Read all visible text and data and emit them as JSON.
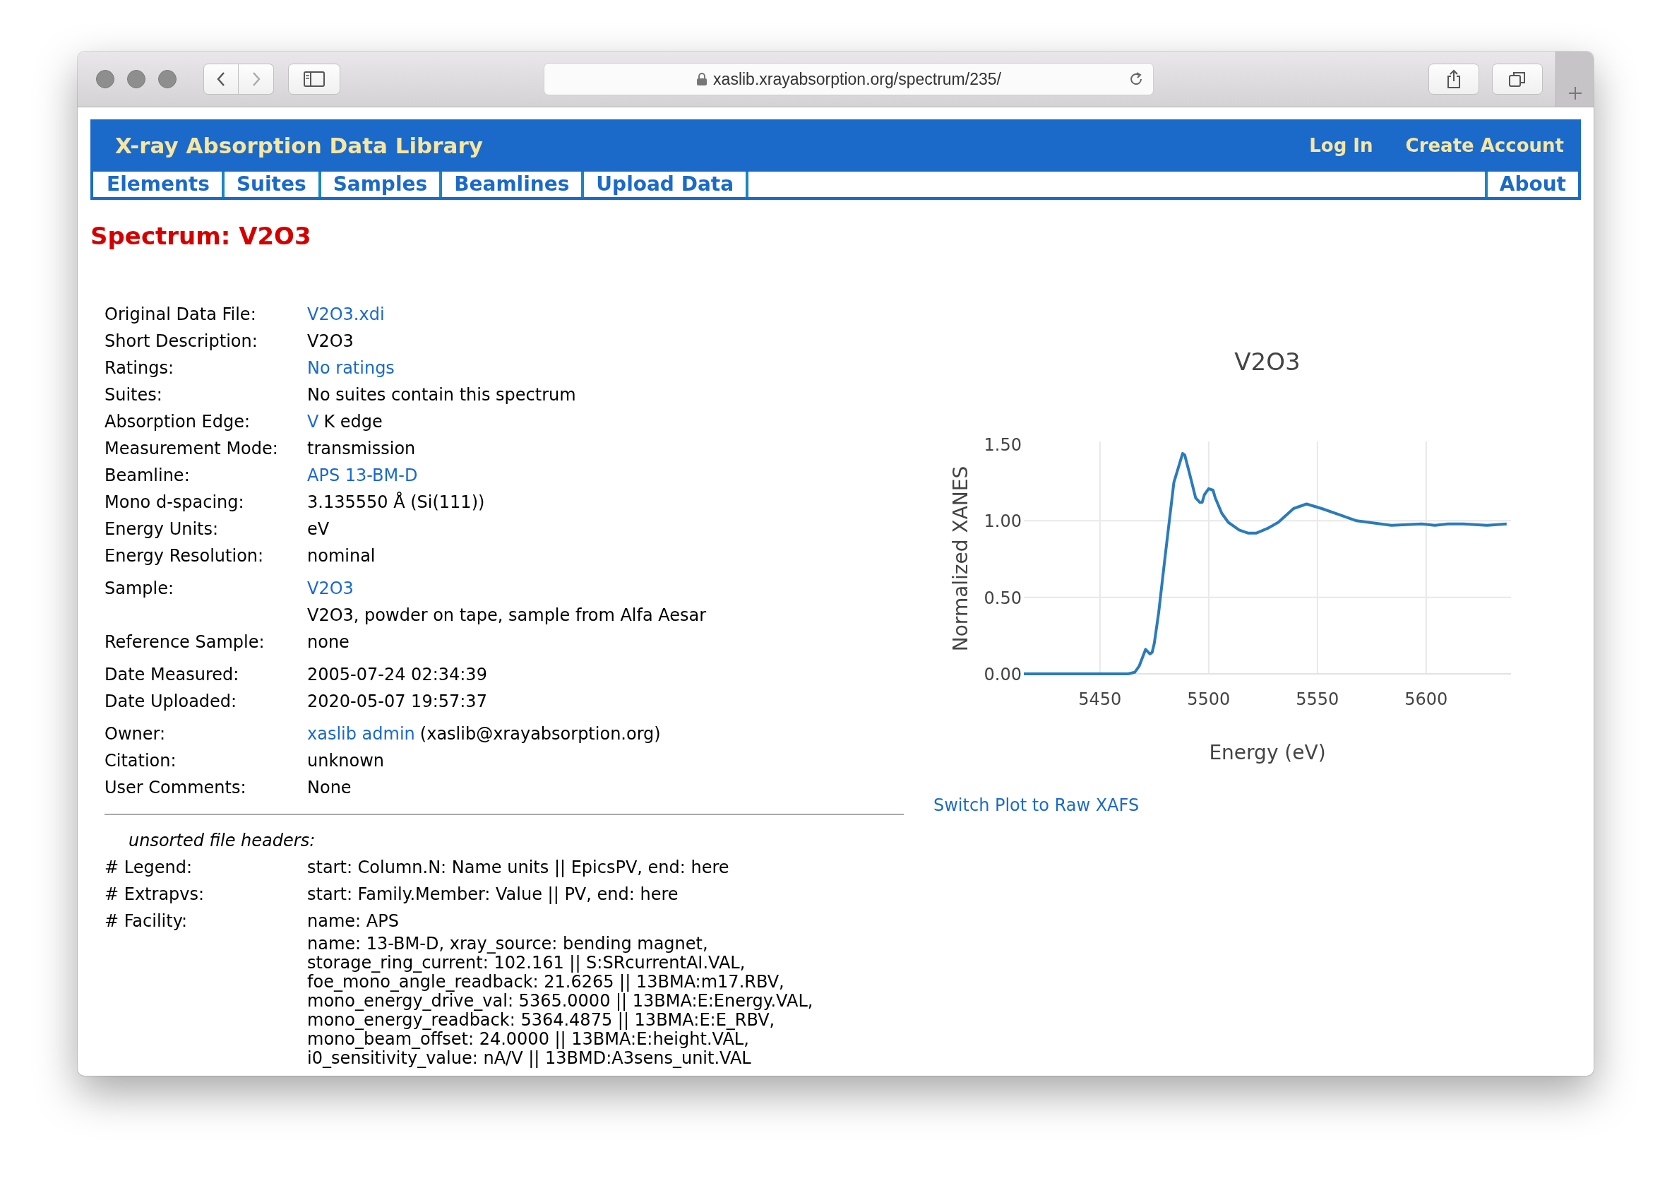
{
  "browser": {
    "url": "xaslib.xrayabsorption.org/spectrum/235/"
  },
  "site": {
    "title": "X-ray Absorption Data Library",
    "account_links": [
      "Log In",
      "Create Account"
    ],
    "nav": [
      {
        "label": "Elements"
      },
      {
        "label": "Suites"
      },
      {
        "label": "Samples"
      },
      {
        "label": "Beamlines"
      },
      {
        "label": "Upload Data"
      }
    ],
    "nav_right": [
      {
        "label": "About"
      }
    ]
  },
  "page_title": "Spectrum: V2O3",
  "details": [
    [
      {
        "label": "Original Data File:",
        "value": [
          {
            "text": "V2O3.xdi",
            "link": true
          }
        ]
      },
      {
        "label": "Short Description:",
        "value": [
          {
            "text": "V2O3",
            "link": false
          }
        ]
      },
      {
        "label": "Ratings:",
        "value": [
          {
            "text": "No ratings",
            "link": true
          }
        ]
      },
      {
        "label": "Suites:",
        "value": [
          {
            "text": "No suites contain this spectrum",
            "link": false
          }
        ]
      },
      {
        "label": "Absorption Edge:",
        "value": [
          {
            "text": "V",
            "link": true
          },
          {
            "text": "K edge",
            "link": false
          }
        ]
      },
      {
        "label": "Measurement Mode:",
        "value": [
          {
            "text": "transmission",
            "link": false
          }
        ]
      },
      {
        "label": "Beamline:",
        "value": [
          {
            "text": "APS 13-BM-D",
            "link": true
          }
        ]
      },
      {
        "label": "Mono d-spacing:",
        "value": [
          {
            "text": "3.135550 Å (Si(111))",
            "link": false
          }
        ]
      },
      {
        "label": "Energy Units:",
        "value": [
          {
            "text": "eV",
            "link": false
          }
        ]
      },
      {
        "label": "Energy Resolution:",
        "value": [
          {
            "text": "nominal",
            "link": false
          }
        ]
      }
    ],
    [
      {
        "label": "Sample:",
        "value": [
          {
            "text": "V2O3",
            "link": true
          }
        ]
      },
      {
        "value": [
          {
            "text": "V2O3, powder on tape, sample from Alfa Aesar",
            "link": false
          }
        ]
      },
      {
        "label": "Reference Sample:",
        "value": [
          {
            "text": "none",
            "link": false
          }
        ]
      }
    ],
    [
      {
        "label": "Date Measured:",
        "value": [
          {
            "text": "2005-07-24 02:34:39",
            "link": false
          }
        ]
      },
      {
        "label": "Date Uploaded:",
        "value": [
          {
            "text": "2020-05-07 19:57:37",
            "link": false
          }
        ]
      }
    ],
    [
      {
        "label": "Owner:",
        "value": [
          {
            "text": "xaslib admin",
            "link": true
          },
          {
            "text": "(xaslib@xrayabsorption.org)",
            "link": false
          }
        ]
      },
      {
        "label": "Citation:",
        "value": [
          {
            "text": "unknown",
            "link": false
          }
        ]
      },
      {
        "label": "User Comments:",
        "value": [
          {
            "text": "None",
            "link": false
          }
        ]
      }
    ]
  ],
  "headers": {
    "heading": "unsorted file headers:",
    "rows": [
      {
        "label": "# Legend:",
        "lines": [
          "start: Column.N: Name units || EpicsPV, end: here"
        ]
      },
      {
        "label": "# Extrapvs:",
        "lines": [
          "start: Family.Member: Value || PV, end: here"
        ]
      },
      {
        "label": "# Facility:",
        "lines": [
          "name: APS"
        ]
      },
      {
        "lines": [
          "name: 13-BM-D, xray_source: bending magnet,",
          "storage_ring_current: 102.161 || S:SRcurrentAI.VAL,",
          "foe_mono_angle_readback: 21.6265 || 13BMA:m17.RBV,",
          "mono_energy_drive_val: 5365.0000 || 13BMA:E:Energy.VAL,",
          "mono_energy_readback: 5364.4875 || 13BMA:E:E_RBV,",
          "mono_beam_offset: 24.0000 || 13BMA:E:height.VAL,",
          "i0_sensitivity_value: nA/V || 13BMD:A3sens_unit.VAL"
        ]
      }
    ]
  },
  "plot": {
    "chart_data": {
      "type": "line",
      "grid": true,
      "title": "V2O3",
      "xlabel": "Energy (eV)",
      "ylabel": "Normalized XANES",
      "xlim": [
        5415,
        5639
      ],
      "ylim": [
        0,
        1.5
      ],
      "xticks": [
        5450,
        5500,
        5550,
        5600
      ],
      "yticks": [
        {
          "value": 0,
          "label": "0.00"
        },
        {
          "value": 0.5,
          "label": "0.50"
        },
        {
          "value": 1,
          "label": "1.00"
        },
        {
          "value": 1.5,
          "label": "1.50"
        }
      ],
      "x": [
        5415,
        5463,
        5466,
        5468,
        5471,
        5473,
        5474,
        5475,
        5477,
        5480,
        5484,
        5488,
        5489,
        5491,
        5494,
        5496,
        5497,
        5498,
        5500,
        5502,
        5503,
        5506,
        5509,
        5514,
        5518,
        5522,
        5527,
        5532,
        5539,
        5545,
        5552,
        5560,
        5568,
        5584,
        5598,
        5604,
        5610,
        5617,
        5628,
        5637
      ],
      "series": [
        {
          "color": "#2b7bba",
          "values": [
            0,
            0,
            0.01,
            0.05,
            0.16,
            0.13,
            0.14,
            0.2,
            0.4,
            0.77,
            1.25,
            1.44,
            1.43,
            1.32,
            1.15,
            1.12,
            1.12,
            1.17,
            1.21,
            1.2,
            1.15,
            1.05,
            0.99,
            0.94,
            0.92,
            0.92,
            0.95,
            0.99,
            1.08,
            1.11,
            1.08,
            1.04,
            1.0,
            0.97,
            0.98,
            0.97,
            0.98,
            0.98,
            0.97,
            0.98
          ]
        }
      ]
    },
    "switch_link": "Switch Plot to Raw XAFS"
  }
}
